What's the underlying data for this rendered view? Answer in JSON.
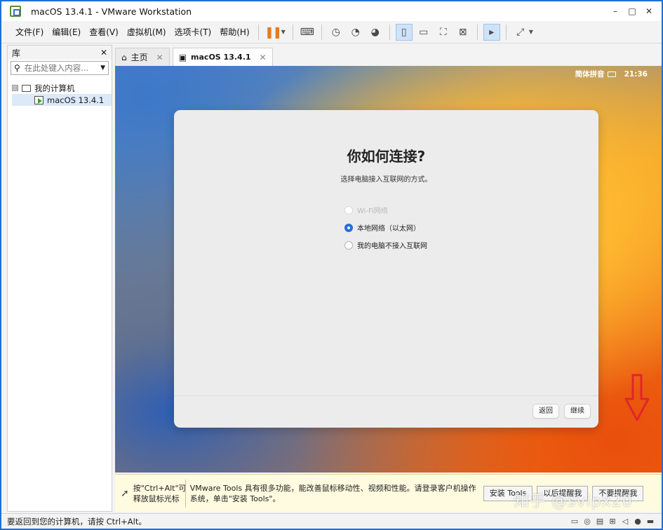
{
  "window": {
    "title": "macOS 13.4.1 - VMware Workstation",
    "controls": {
      "minimize": "–",
      "maximize": "□",
      "close": "✕"
    }
  },
  "menu": {
    "items": [
      "文件(F)",
      "编辑(E)",
      "查看(V)",
      "虚拟机(M)",
      "选项卡(T)",
      "帮助(H)"
    ]
  },
  "toolbar": {
    "pause_icon": "pause-icon",
    "icons": [
      "send-keys-icon",
      "snapshot-icon",
      "revert-snapshot-icon",
      "manage-snapshots-icon",
      "library-view-icon",
      "thumbnail-view-icon",
      "fullscreen-icon",
      "unity-icon",
      "console-icon",
      "stretch-icon"
    ]
  },
  "library": {
    "title": "库",
    "close": "✕",
    "search_placeholder": "在此处键入内容...",
    "tree": {
      "root_label": "我的计算机",
      "expander": "⊟",
      "child_label": "macOS 13.4.1"
    }
  },
  "tabs": [
    {
      "label": "主页",
      "icon": "home-icon",
      "close": "✕"
    },
    {
      "label": "macOS 13.4.1",
      "icon": "vm-icon",
      "close": "✕"
    }
  ],
  "vm": {
    "status": {
      "input_method": "简体拼音",
      "time": "21:36"
    },
    "dialog": {
      "title": "你如何连接?",
      "subtitle": "选择电脑接入互联网的方式。",
      "options": [
        {
          "label": "Wi-Fi网络",
          "state": "disabled"
        },
        {
          "label": "本地网络（以太网）",
          "state": "selected"
        },
        {
          "label": "我的电脑不接入互联网",
          "state": "unselected"
        }
      ],
      "back_label": "返回",
      "continue_label": "继续"
    },
    "annotation_color": "#e0262c"
  },
  "notice": {
    "hint": "按\"Ctrl+Alt\"可释放鼠标光标",
    "message": "VMware Tools 具有很多功能，能改善鼠标移动性、视频和性能。请登录客户机操作系统，单击\"安装 Tools\"。",
    "install_label": "安装 Tools",
    "remind_later_label": "以后提醒我",
    "never_remind_label": "不要提醒我"
  },
  "watermark": "知乎 @svipx20",
  "statusbar": {
    "text": "要返回到您的计算机，请按 Ctrl+Alt。",
    "icons": [
      "hdd-icon",
      "cd-icon",
      "floppy-icon",
      "network-icon",
      "sound-icon",
      "usb-icon",
      "display-icon"
    ]
  },
  "colors": {
    "window_border": "#1d6fd8",
    "radio_selected": "#1f6fdb",
    "pause_accent": "#e8791c"
  }
}
